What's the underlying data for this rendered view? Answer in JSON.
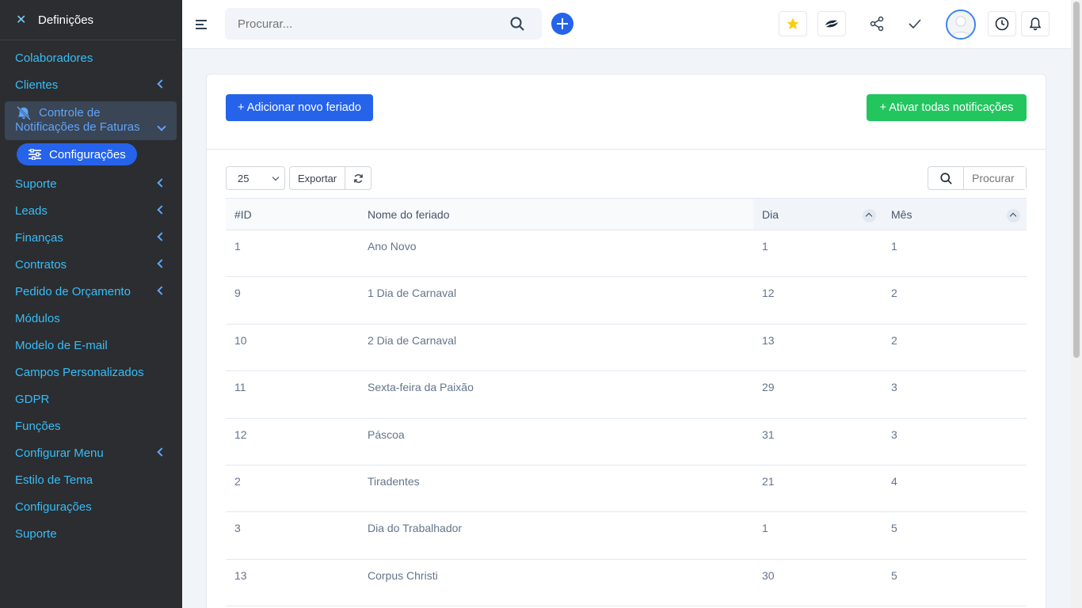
{
  "sidebar": {
    "header_title": "Definições",
    "items_top": [
      {
        "label": "Colaboradores",
        "chevron": false
      },
      {
        "label": "Clientes",
        "chevron": true
      }
    ],
    "active": {
      "line1": "Controle de",
      "line2": "Notificações de Faturas"
    },
    "sub_item": "Configurações",
    "items_bottom": [
      {
        "label": "Suporte",
        "chevron": true
      },
      {
        "label": "Leads",
        "chevron": true
      },
      {
        "label": "Finanças",
        "chevron": true
      },
      {
        "label": "Contratos",
        "chevron": true
      },
      {
        "label": "Pedido de Orçamento",
        "chevron": true
      },
      {
        "label": "Módulos",
        "chevron": false
      },
      {
        "label": "Modelo de E-mail",
        "chevron": false
      },
      {
        "label": "Campos Personalizados",
        "chevron": false
      },
      {
        "label": "GDPR",
        "chevron": false
      },
      {
        "label": "Funções",
        "chevron": false
      },
      {
        "label": "Configurar Menu",
        "chevron": true
      },
      {
        "label": "Estilo de Tema",
        "chevron": false
      },
      {
        "label": "Configurações",
        "chevron": false
      },
      {
        "label": "Suporte",
        "chevron": false
      }
    ]
  },
  "topbar": {
    "search_placeholder": "Procurar...",
    "icons": [
      "star-icon",
      "app-logo-icon",
      "share-icon",
      "check-icon",
      "avatar",
      "clock-icon",
      "bell-icon"
    ]
  },
  "card": {
    "add_button": "+ Adicionar novo feriado",
    "activate_button": "+ Ativar todas notificações"
  },
  "controls": {
    "page_size": "25",
    "export_label": "Exportar",
    "search_placeholder": "Procurar"
  },
  "table": {
    "headers": [
      "#ID",
      "Nome do feriado",
      "Dia",
      "Mês"
    ],
    "rows": [
      [
        "1",
        "Ano Novo",
        "1",
        "1"
      ],
      [
        "9",
        "1 Dia de Carnaval",
        "12",
        "2"
      ],
      [
        "10",
        "2 Dia de Carnaval",
        "13",
        "2"
      ],
      [
        "11",
        "Sexta-feira da Paixão",
        "29",
        "3"
      ],
      [
        "12",
        "Páscoa",
        "31",
        "3"
      ],
      [
        "2",
        "Tiradentes",
        "21",
        "4"
      ],
      [
        "3",
        "Dia do Trabalhador",
        "1",
        "5"
      ],
      [
        "13",
        "Corpus Christi",
        "30",
        "5"
      ]
    ]
  },
  "colors": {
    "sidebar_bg": "#2b2d30",
    "sidebar_text": "#38bdf8",
    "primary": "#2563eb",
    "success": "#22c55e"
  }
}
